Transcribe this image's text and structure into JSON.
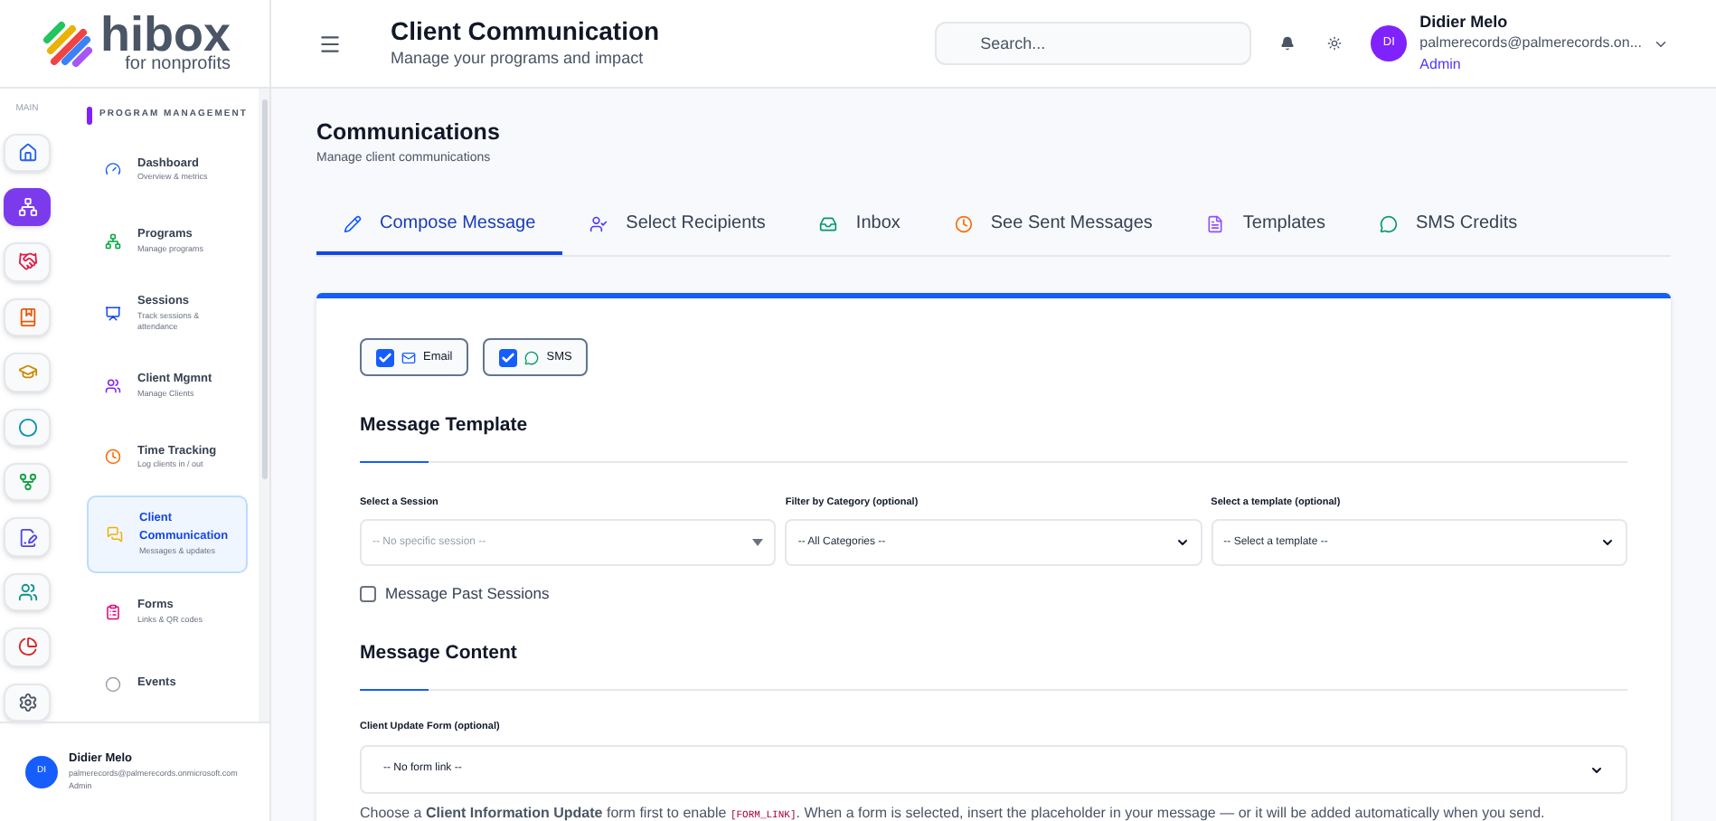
{
  "brand": {
    "name": "hibox",
    "tagline": "for nonprofits"
  },
  "header": {
    "title": "Client Communication",
    "subtitle": "Manage your programs and impact",
    "search": {
      "placeholder": "Search..."
    },
    "user": {
      "initials": "DI",
      "name": "Didier Melo",
      "email": "palmerecords@palmerecords.on...",
      "role": "Admin"
    }
  },
  "rail": {
    "label": "MAIN",
    "items": [
      {
        "selected": false,
        "color": "#2563eb"
      },
      {
        "selected": true,
        "color": "#7c3aed"
      },
      {
        "selected": false,
        "color": "#e11d48"
      },
      {
        "selected": false,
        "color": "#ea580c"
      },
      {
        "selected": false,
        "color": "#ca8a04"
      },
      {
        "selected": false,
        "color": "#0891b2"
      },
      {
        "selected": false,
        "color": "#16a34a"
      },
      {
        "selected": false,
        "color": "#4f46e5"
      },
      {
        "selected": false,
        "color": "#0d9488"
      },
      {
        "selected": false,
        "color": "#dc2626"
      },
      {
        "selected": false,
        "color": "#4b5563"
      }
    ]
  },
  "nav": {
    "section": "PROGRAM MANAGEMENT",
    "items": [
      {
        "title": "Dashboard",
        "subtitle": "Overview & metrics",
        "selected": false
      },
      {
        "title": "Programs",
        "subtitle": "Manage programs",
        "selected": false
      },
      {
        "title": "Sessions",
        "subtitle": "Track sessions & attendance",
        "selected": false
      },
      {
        "title": "Client Mgmnt",
        "subtitle": "Manage Clients",
        "selected": false
      },
      {
        "title": "Time Tracking",
        "subtitle": "Log clients in / out",
        "selected": false
      },
      {
        "title": "Client Communication",
        "subtitle": "Messages & updates",
        "selected": true
      },
      {
        "title": "Forms",
        "subtitle": "Links & QR codes",
        "selected": false
      },
      {
        "title": "Events",
        "selected": false
      }
    ]
  },
  "sidebar_user": {
    "initials": "DI",
    "name": "Didier Melo",
    "email": "palmerecords@palmerecords.onmicrosoft.com",
    "role": "Admin"
  },
  "page": {
    "title": "Communications",
    "subtitle": "Manage client communications"
  },
  "tabs": [
    {
      "label": "Compose Message",
      "selected": true
    },
    {
      "label": "Select Recipients",
      "selected": false
    },
    {
      "label": "Inbox",
      "selected": false
    },
    {
      "label": "See Sent Messages",
      "selected": false
    },
    {
      "label": "Templates",
      "selected": false
    },
    {
      "label": "SMS Credits",
      "selected": false
    }
  ],
  "channels": [
    {
      "label": "Email",
      "checked": true
    },
    {
      "label": "SMS",
      "checked": true
    }
  ],
  "template_section": {
    "heading": "Message Template",
    "fields": [
      {
        "label": "Select a Session",
        "placeholder": "-- No specific session --"
      },
      {
        "label": "Filter by Category (optional)",
        "value": "-- All Categories --"
      },
      {
        "label": "Select a template (optional)",
        "value": "-- Select a template --"
      }
    ],
    "past_sessions": {
      "label": "Message Past Sessions",
      "checked": false
    }
  },
  "content_section": {
    "heading": "Message Content",
    "form_field": {
      "label": "Client Update Form (optional)",
      "value": "-- No form link --"
    },
    "help": [
      {
        "kind": "rich",
        "text": "Choose a **Client Information Update** form first to enable "
      },
      {
        "kind": "code",
        "text": "[FORM_LINK]"
      },
      {
        "kind": "rich",
        "text": ". When a form is selected, insert the placeholder in your message — or it will be added automatically when you send."
      }
    ]
  }
}
